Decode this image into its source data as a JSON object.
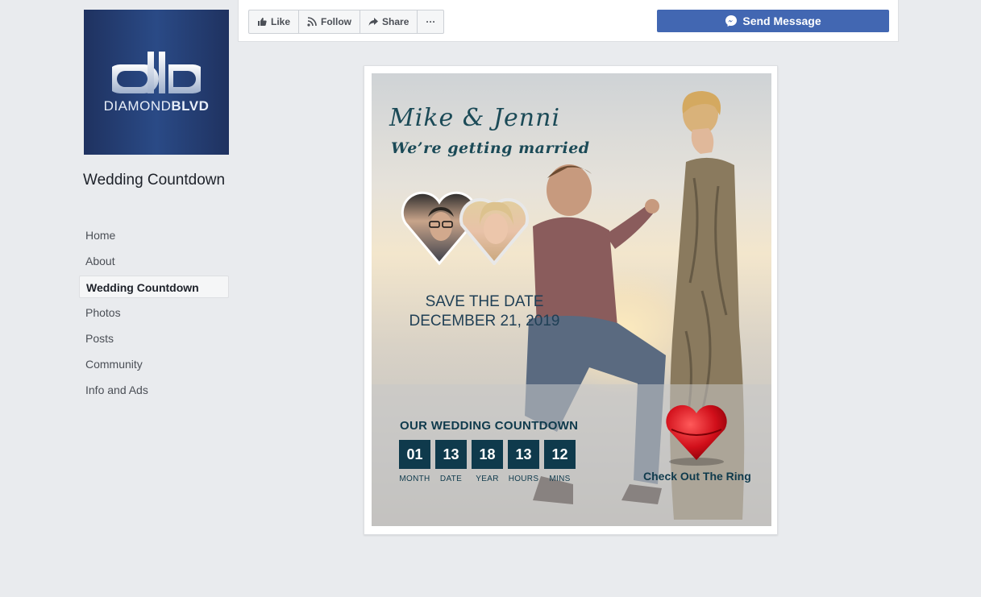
{
  "brand": {
    "logo_text_light": "DIAMOND",
    "logo_text_bold": "BLVD",
    "logo_bg": "#1f3260"
  },
  "page": {
    "name": "Wedding Countdown"
  },
  "nav": {
    "items": [
      "Home",
      "About",
      "Wedding Countdown",
      "Photos",
      "Posts",
      "Community",
      "Info and Ads"
    ],
    "active": "Wedding Countdown"
  },
  "actionbar": {
    "like": "Like",
    "follow": "Follow",
    "share": "Share",
    "more": "···",
    "send_message": "Send Message",
    "accent": "#4267b2"
  },
  "poster": {
    "couple": "Mike  &  Jenni",
    "tagline": "We’re getting married",
    "save_line1": "SAVE THE DATE",
    "save_line2": "DECEMBER 21, 2019",
    "countdown_title": "OUR WEDDING COUNTDOWN",
    "countdown": [
      {
        "value": "01",
        "label": "MONTH"
      },
      {
        "value": "13",
        "label": "DATE"
      },
      {
        "value": "18",
        "label": "YEAR"
      },
      {
        "value": "13",
        "label": "HOURS"
      },
      {
        "value": "12",
        "label": "MINS"
      }
    ],
    "ring_link": "Check Out The Ring",
    "accent": "#0f3a4c"
  }
}
